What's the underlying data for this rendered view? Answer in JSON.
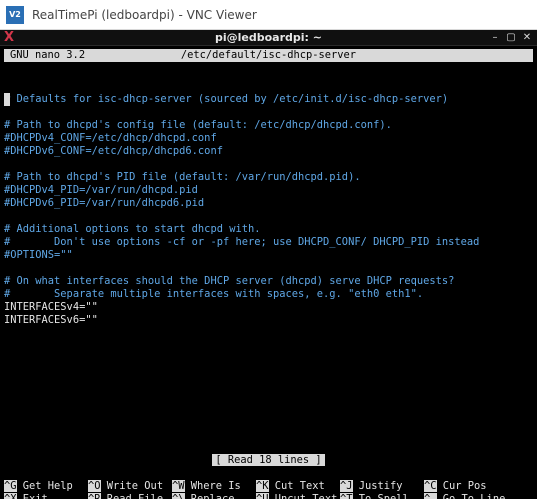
{
  "vnc": {
    "icon": "V2",
    "title": "RealTimePi (ledboardpi) - VNC Viewer"
  },
  "terminal": {
    "title": "pi@ledboardpi: ~",
    "buttons": [
      "–",
      "▢",
      "✕"
    ]
  },
  "nano": {
    "version": "GNU nano 3.2",
    "filename": "/etc/default/isc-dhcp-server",
    "lines": [
      {
        "text": "# Defaults for isc-dhcp-server (sourced by /etc/init.d/isc-dhcp-server)",
        "kind": "comment"
      },
      {
        "text": "",
        "kind": "plain"
      },
      {
        "text": "# Path to dhcpd's config file (default: /etc/dhcp/dhcpd.conf).",
        "kind": "comment"
      },
      {
        "text": "#DHCPDv4_CONF=/etc/dhcp/dhcpd.conf",
        "kind": "comment"
      },
      {
        "text": "#DHCPDv6_CONF=/etc/dhcp/dhcpd6.conf",
        "kind": "comment"
      },
      {
        "text": "",
        "kind": "plain"
      },
      {
        "text": "# Path to dhcpd's PID file (default: /var/run/dhcpd.pid).",
        "kind": "comment"
      },
      {
        "text": "#DHCPDv4_PID=/var/run/dhcpd.pid",
        "kind": "comment"
      },
      {
        "text": "#DHCPDv6_PID=/var/run/dhcpd6.pid",
        "kind": "comment"
      },
      {
        "text": "",
        "kind": "plain"
      },
      {
        "text": "# Additional options to start dhcpd with.",
        "kind": "comment"
      },
      {
        "text": "#       Don't use options -cf or -pf here; use DHCPD_CONF/ DHCPD_PID instead",
        "kind": "comment"
      },
      {
        "text": "#OPTIONS=\"\"",
        "kind": "comment"
      },
      {
        "text": "",
        "kind": "plain"
      },
      {
        "text": "# On what interfaces should the DHCP server (dhcpd) serve DHCP requests?",
        "kind": "comment"
      },
      {
        "text": "#       Separate multiple interfaces with spaces, e.g. \"eth0 eth1\".",
        "kind": "comment"
      },
      {
        "text": "INTERFACESv4=\"\"",
        "kind": "plain"
      },
      {
        "text": "INTERFACESv6=\"\"",
        "kind": "plain"
      }
    ],
    "status": "[ Read 18 lines ]",
    "shortcuts": [
      [
        {
          "key": "^G",
          "label": "Get Help"
        },
        {
          "key": "^O",
          "label": "Write Out"
        },
        {
          "key": "^W",
          "label": "Where Is"
        },
        {
          "key": "^K",
          "label": "Cut Text"
        },
        {
          "key": "^J",
          "label": "Justify"
        },
        {
          "key": "^C",
          "label": "Cur Pos"
        }
      ],
      [
        {
          "key": "^X",
          "label": "Exit"
        },
        {
          "key": "^R",
          "label": "Read File"
        },
        {
          "key": "^\\",
          "label": "Replace"
        },
        {
          "key": "^U",
          "label": "Uncut Text"
        },
        {
          "key": "^T",
          "label": "To Spell"
        },
        {
          "key": "^_",
          "label": "Go To Line"
        }
      ]
    ]
  },
  "colors": {
    "comment": "#5fa7e6",
    "text": "#e6e6e6",
    "bar": "#d9d9d9"
  }
}
